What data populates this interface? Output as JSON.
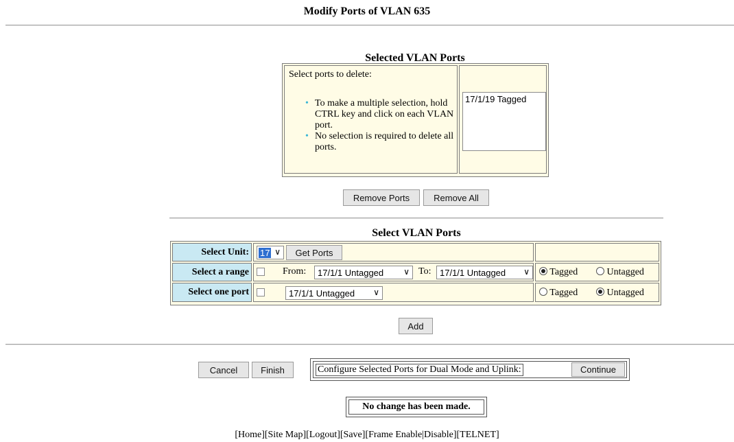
{
  "page": {
    "title": "Modify Ports of VLAN 635"
  },
  "selected_ports": {
    "heading": "Selected VLAN Ports",
    "instruction": "Select ports to delete:",
    "tips": [
      "To make a multiple selection, hold CTRL key and click on each VLAN port.",
      "No selection is required to delete all ports."
    ],
    "ports": [
      "17/1/19 Tagged"
    ],
    "remove_ports_label": "Remove Ports",
    "remove_all_label": "Remove All"
  },
  "select_ports": {
    "heading": "Select VLAN Ports",
    "unit_label": "Select Unit:",
    "unit_value": "17",
    "get_ports_label": "Get Ports",
    "range_label": "Select a range",
    "from_label": "From:",
    "from_value": "17/1/1 Untagged",
    "to_label": "To:",
    "to_value": "17/1/1 Untagged",
    "range_tagged_label": "Tagged",
    "range_untagged_label": "Untagged",
    "range_mode": "Tagged",
    "one_port_label": "Select one port",
    "one_port_value": "17/1/1 Untagged",
    "one_tagged_label": "Tagged",
    "one_untagged_label": "Untagged",
    "one_mode": "Untagged",
    "add_label": "Add"
  },
  "actions": {
    "cancel_label": "Cancel",
    "finish_label": "Finish",
    "dual_mode_text": "Configure Selected Ports for Dual Mode and Uplink:",
    "continue_label": "Continue"
  },
  "status": {
    "message": "No change has been made."
  },
  "footer": {
    "links": [
      "[Home]",
      "[Site Map]",
      "[Logout]",
      "[Save]",
      "[Frame Enable",
      "|",
      "Disable]",
      "[TELNET]"
    ]
  },
  "colors": {
    "cream": "#fffce6",
    "label_blue": "#c9e9f3",
    "bullet": "#3bb7d6"
  }
}
